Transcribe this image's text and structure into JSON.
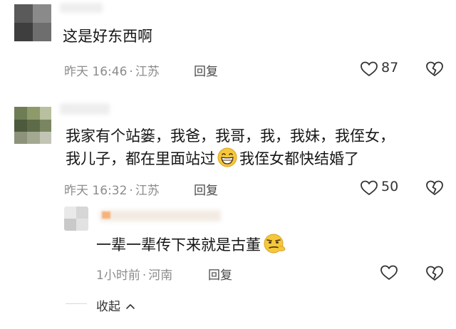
{
  "comments": [
    {
      "text_lines": [
        "这是好东西啊"
      ],
      "time": "昨天 16:46",
      "location": "江苏",
      "reply_label": "回复",
      "likes": "87"
    },
    {
      "text_lines": [
        "我家有个站篓，我爸，我哥，我，我妹，我侄女，",
        "我儿子，都在里面站过",
        "我侄女都快结婚了"
      ],
      "emoji": "grinning-face",
      "time": "昨天 16:32",
      "location": "江苏",
      "reply_label": "回复",
      "likes": "50"
    }
  ],
  "reply": {
    "text": "一辈一辈传下来就是古董",
    "emoji": "smirking-face",
    "time": "1小时前",
    "location": "河南",
    "reply_label": "回复"
  },
  "collapse_label": "收起",
  "collapse_icon": "chevron-up",
  "meta_separator": "·",
  "colors": {
    "text": "#161616",
    "meta": "#8c8c8c",
    "background": "#ffffff",
    "emoji": "#f5c73b"
  }
}
